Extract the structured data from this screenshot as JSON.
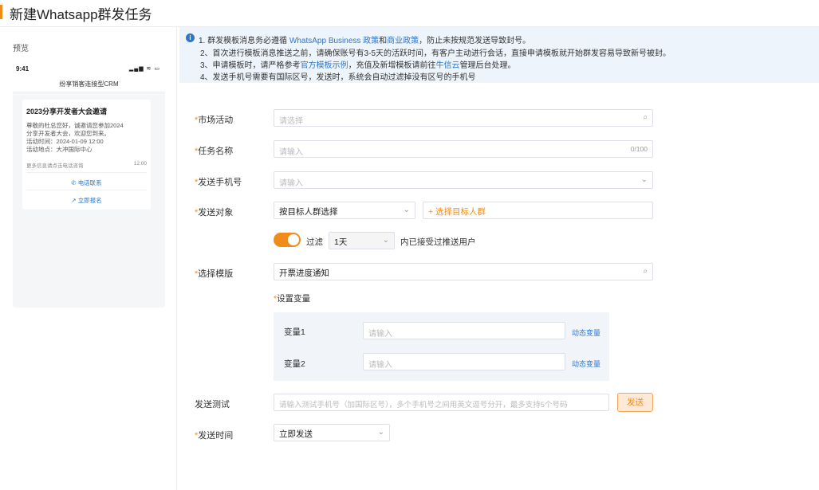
{
  "page": {
    "title": "新建Whatsapp群发任务"
  },
  "preview": {
    "label": "预览",
    "status_time": "9:41",
    "status_icons": "▂▄▆ ≋ ▭",
    "nav_title": "纷享销客连接型CRM",
    "card": {
      "title": "2023分享开发者大会邀请",
      "body": [
        "尊敬的杜总您好，诚邀请您参加2024",
        "分享开发者大会，欢迎您到来。",
        "活动时间：2024-01-09 12:00",
        "活动地点：大冲国际中心"
      ],
      "footer_left": "更多信息请点击电话咨询",
      "footer_time": "12:00",
      "link1": "电话联系",
      "link2": "立即报名"
    }
  },
  "notice": {
    "line1_pre": "1. 群发模板消息务必遵循 ",
    "line1_link1": "WhatsApp Business 政策",
    "line1_mid": "和",
    "line1_link2": "商业政策",
    "line1_post": "，防止未按规范发送导致封号。",
    "line2": "2、首次进行模板消息推送之前，请确保账号有3-5天的活跃时间，有客户主动进行会话，直接申请模板就开始群发容易导致新号被封。",
    "line3_pre": "3、申请模板时，请严格参考",
    "line3_link1": "官方模板示例",
    "line3_mid": "，充值及新增模板请前往",
    "line3_link2": "牛信云",
    "line3_post": "管理后台处理。",
    "line4": "4、发送手机号需要有国际区号，发送时，系统会自动过滤掉没有区号的手机号"
  },
  "form": {
    "campaign": {
      "label": "市场活动",
      "placeholder": "请选择"
    },
    "task_name": {
      "label": "任务名称",
      "placeholder": "请输入",
      "counter": "0/100"
    },
    "phone": {
      "label": "发送手机号",
      "placeholder": "请输入"
    },
    "target": {
      "label": "发送对象",
      "value": "按目标人群选择",
      "add_label": "+ 选择目标人群"
    },
    "filter": {
      "label": "过滤",
      "days": "1天",
      "suffix": "内已接受过推送用户",
      "enabled": true
    },
    "template": {
      "label": "选择模版",
      "value": "开票进度通知"
    },
    "variables": {
      "label": "设置变量",
      "items": [
        {
          "label": "变量1",
          "placeholder": "请输入",
          "action": "动态变量"
        },
        {
          "label": "变量2",
          "placeholder": "请输入",
          "action": "动态变量"
        }
      ]
    },
    "test": {
      "label": "发送测试",
      "placeholder": "请输入测试手机号（加国际区号），多个手机号之间用英文逗号分开，最多支持5个号码",
      "button": "发送"
    },
    "send_time": {
      "label": "发送时间",
      "value": "立即发送"
    },
    "required_mark": "*"
  },
  "colors": {
    "accent": "#f08c1a",
    "link": "#2f76c8",
    "notice_bg": "#edf4fb"
  }
}
